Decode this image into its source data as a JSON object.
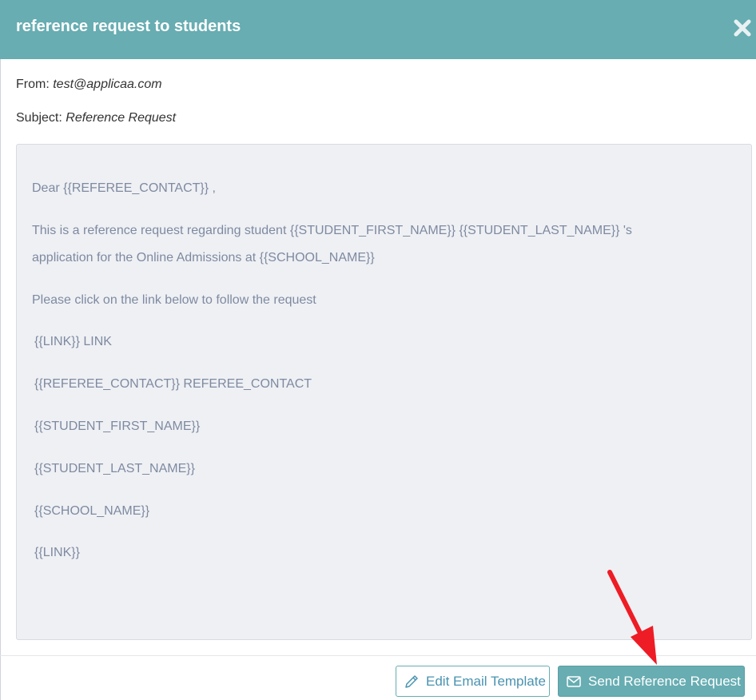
{
  "header": {
    "title": "reference request to students"
  },
  "email": {
    "from_label": "From:",
    "from_value": "test@applicaa.com",
    "subject_label": "Subject:",
    "subject_value": "Reference Request"
  },
  "body": {
    "lines": [
      "Dear  {{REFEREE_CONTACT}} ,",
      "This is a reference request regarding student  {{STUDENT_FIRST_NAME}}   {{STUDENT_LAST_NAME}} 's",
      "application for the Online Admissions at  {{SCHOOL_NAME}}",
      "Please click on the link below to follow the request",
      "{{LINK}}  LINK",
      "{{REFEREE_CONTACT}}  REFEREE_CONTACT",
      "{{STUDENT_FIRST_NAME}}",
      "{{STUDENT_LAST_NAME}}",
      "{{SCHOOL_NAME}}",
      "{{LINK}}"
    ]
  },
  "footer": {
    "edit_label": "Edit Email Template",
    "send_label": "Send Reference Request"
  },
  "icons": {
    "close": "close-icon",
    "edit": "pencil-icon",
    "send": "envelope-icon"
  },
  "colors": {
    "header_bg": "#67adb2",
    "body_bg": "#eef0f4",
    "body_text": "#7f8aa0",
    "edit_text": "#4a93b0",
    "annotation_arrow": "#ee1c24"
  }
}
